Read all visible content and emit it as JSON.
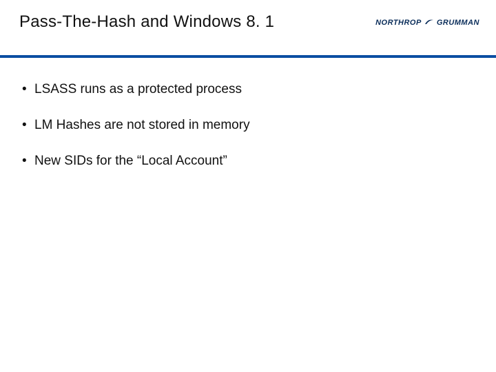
{
  "slide": {
    "title": "Pass-The-Hash and Windows 8. 1",
    "logo": {
      "word1": "NORTHROP",
      "word2": "GRUMMAN"
    },
    "bullets": [
      "LSASS runs as a protected process",
      "LM Hashes are not stored in memory",
      "New SIDs for the “Local Account”"
    ]
  }
}
